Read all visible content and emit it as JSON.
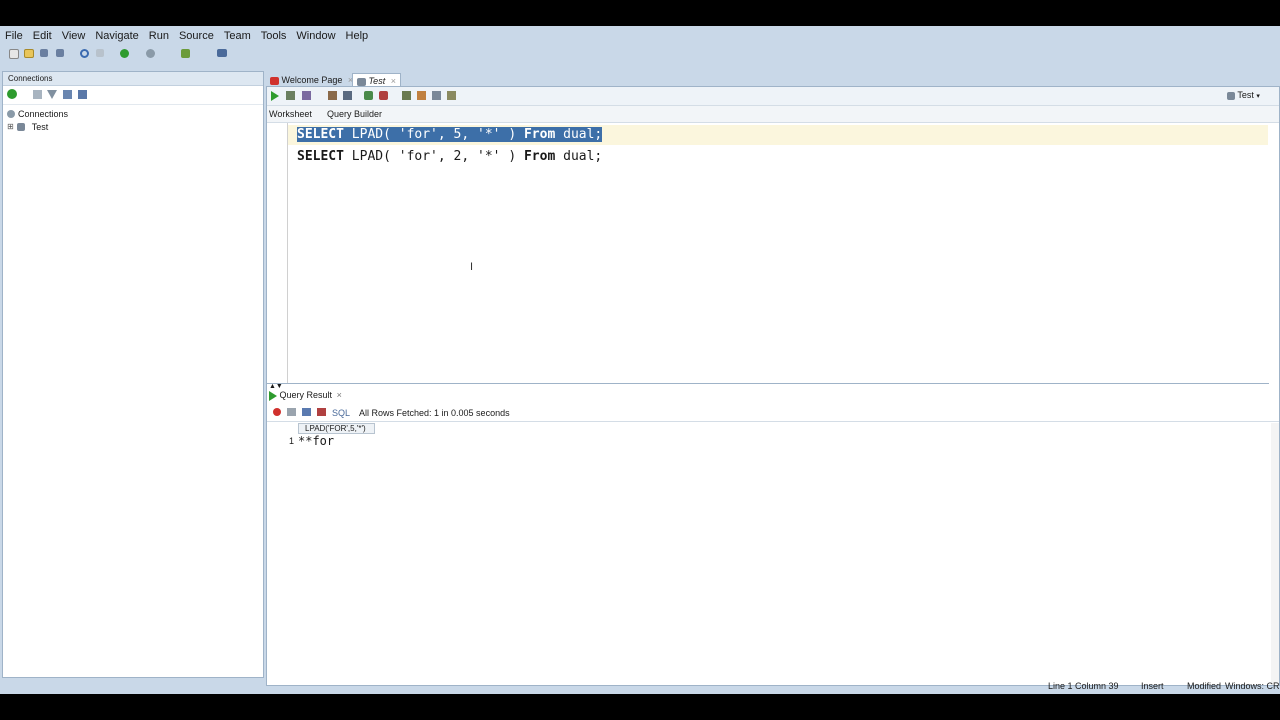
{
  "menu": [
    "File",
    "Edit",
    "View",
    "Navigate",
    "Run",
    "Source",
    "Team",
    "Tools",
    "Window",
    "Help"
  ],
  "left_panel": {
    "title": "Connections",
    "tree": [
      {
        "label": "Connections",
        "icon": "connections-icon"
      },
      {
        "label": "Test",
        "icon": "database-icon"
      }
    ]
  },
  "editor_tabs": [
    {
      "label": "Welcome Page",
      "icon": "welcome-icon"
    },
    {
      "label": "Test",
      "icon": "sql-worksheet-icon"
    }
  ],
  "connection_selector": "Test",
  "subtabs": [
    "Worksheet",
    "Query Builder"
  ],
  "code": {
    "line1": {
      "kw1": "SELECT",
      "mid": " LPAD( 'for', 5, '*' )",
      "kw2": "From",
      "tail": " dual;"
    },
    "line2": {
      "kw1": "SELECT",
      "mid": " LPAD( 'for', 2, '*' )",
      "kw2": "From",
      "tail": " dual;"
    }
  },
  "result": {
    "tab_label": "Query Result",
    "sql_label": "SQL",
    "status": "All Rows Fetched: 1 in 0.005 seconds",
    "column_header": "LPAD('FOR',5,'*')",
    "rows": [
      {
        "num": "1",
        "value": "**for"
      }
    ]
  },
  "status_bar": {
    "position": "Line 1 Column 39",
    "mode": "Insert",
    "modified": "Modified",
    "line_endings": "Windows: CR"
  },
  "colors": {
    "chrome_bg": "#c9d8e8",
    "selection": "#3d6fa8",
    "run_green": "#2e9b2e",
    "close_red": "#d0312d"
  }
}
